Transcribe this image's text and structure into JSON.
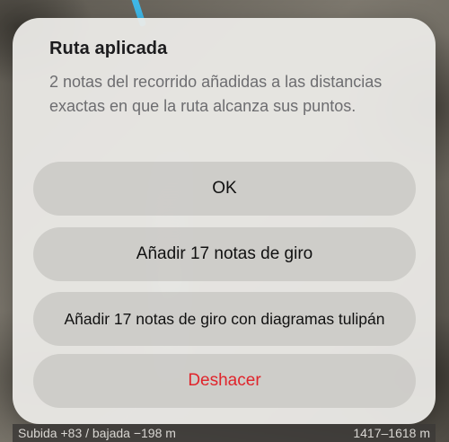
{
  "dialog": {
    "title": "Ruta aplicada",
    "message": "2 notas del recorrido añadidas a las distancias exactas en que la ruta alcanza sus puntos."
  },
  "buttons": {
    "ok": "OK",
    "add_turns": "Añadir 17 notas de giro",
    "add_turns_tulip": "Añadir 17 notas de giro con diagramas tulipán",
    "undo": "Deshacer"
  },
  "status_bar": {
    "elevation": "Subida +83 / bajada −198 m",
    "range": "1417–1618 m"
  },
  "colors": {
    "destructive": "#e0242b",
    "route": "#3fb8e8"
  }
}
